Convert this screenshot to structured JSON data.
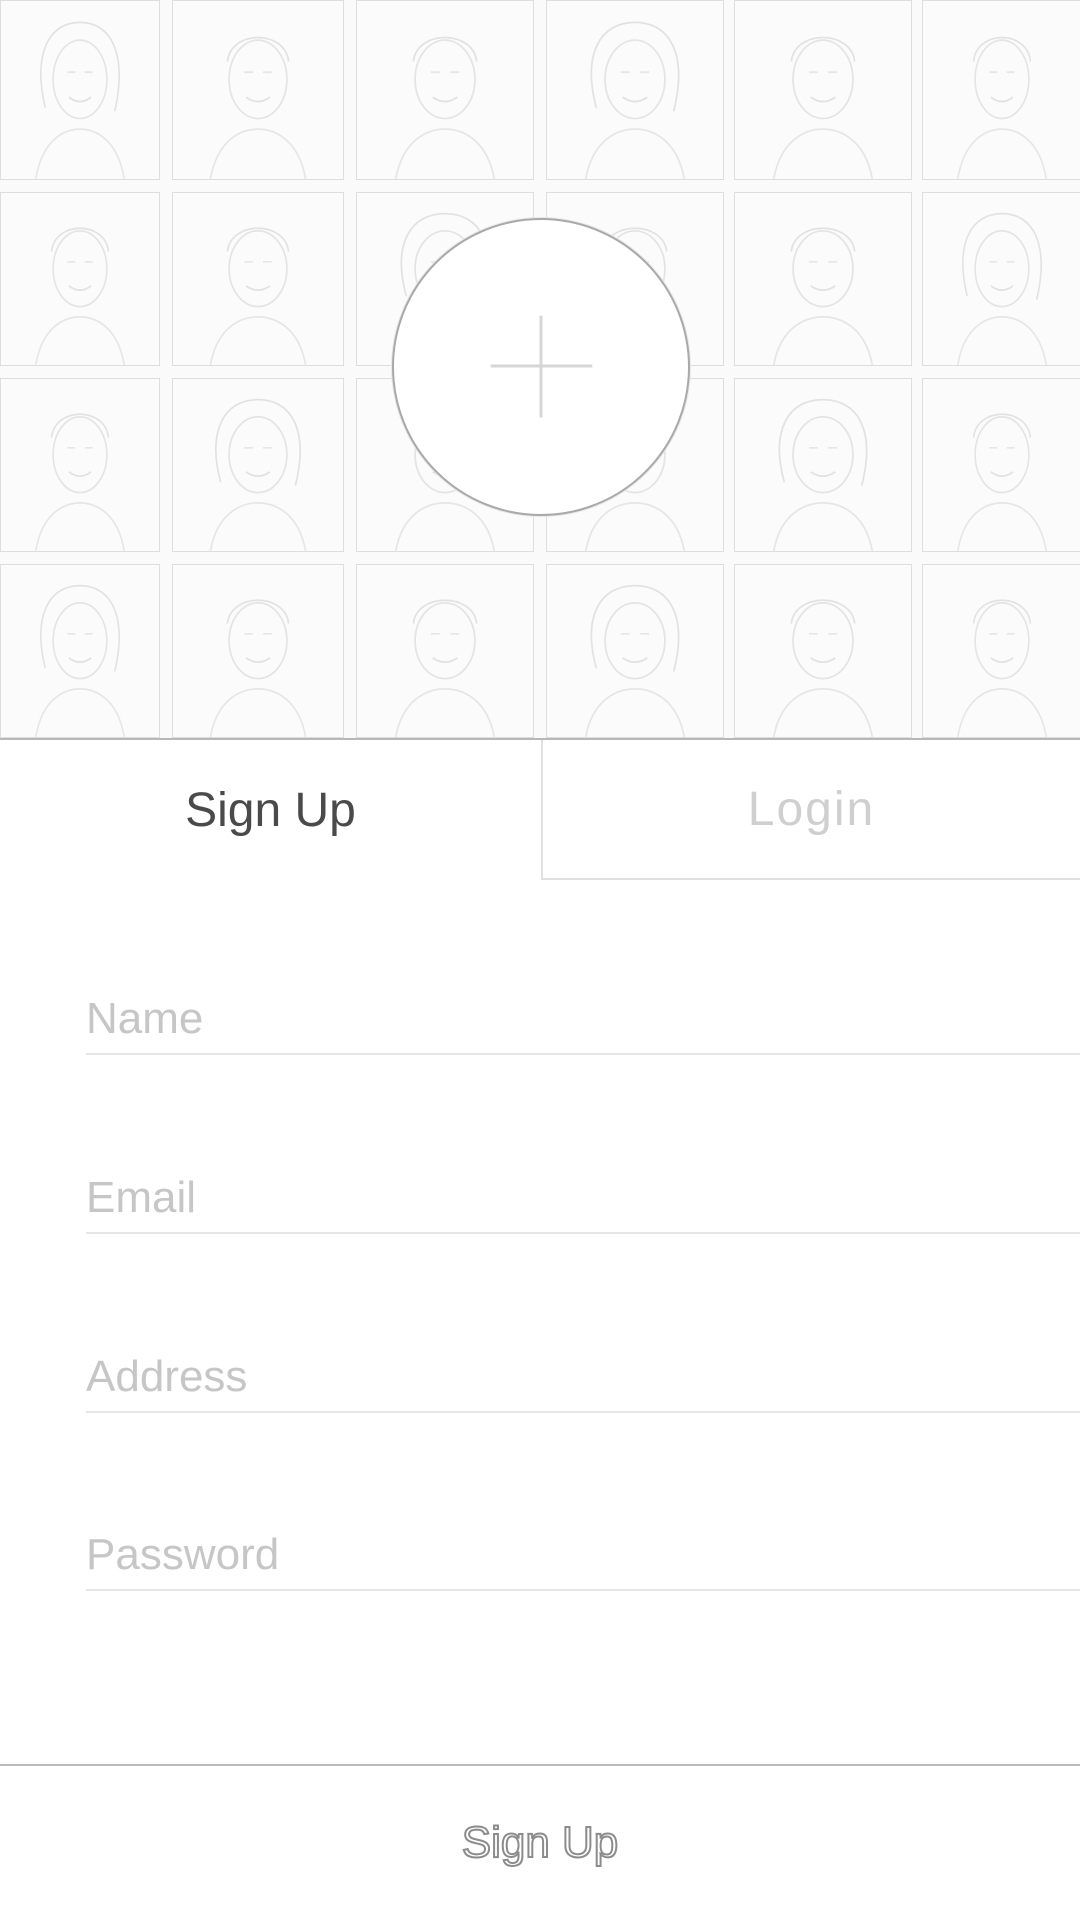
{
  "header": {
    "background_color": "#fafafa",
    "tile_style": "pencil-sketch-portrait",
    "add_photo_icon": "plus-icon"
  },
  "tabs": [
    {
      "label": "Sign Up",
      "active": true
    },
    {
      "label": "Login",
      "active": false
    }
  ],
  "form": {
    "name_placeholder": "Name",
    "email_placeholder": "Email",
    "address_placeholder": "Address",
    "password_placeholder": "Password"
  },
  "footer": {
    "signup_button_label": "Sign Up"
  },
  "colors": {
    "active_tab_text": "#4a4a4a",
    "inactive_tab_text": "#cfcfcf",
    "placeholder_text": "#c6c6c6",
    "divider": "#b9b9b9"
  }
}
